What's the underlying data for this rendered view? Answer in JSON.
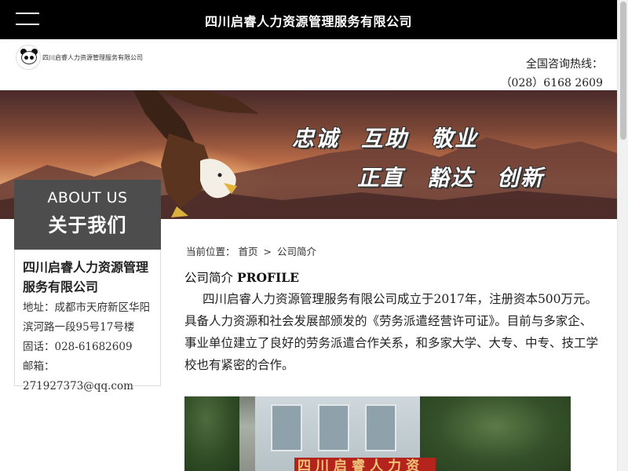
{
  "header": {
    "site_title": "四川启睿人力资源管理服务有限公司",
    "logo_text": "四川启睿人力资源管理服务有限公司",
    "hotline_label": "全国咨询热线：",
    "hotline_number": "（028）6168 2609"
  },
  "banner": {
    "slogans": [
      "忠诚",
      "互助",
      "敬业",
      "正直",
      "豁达",
      "创新"
    ]
  },
  "sidebar": {
    "about_en": "ABOUT US",
    "about_cn": "关于我们",
    "company_name": "四川启睿人力资源管理服务有限公司",
    "address": "地址：成都市天府新区华阳滨河路一段95号17号楼",
    "phone": "固话：028-61682609",
    "email": "邮箱：271927373@qq.com"
  },
  "content": {
    "breadcrumb_label": "当前位置：",
    "breadcrumb_home": "首页",
    "breadcrumb_sep": ">",
    "breadcrumb_current": "公司简介",
    "section_title_cn": "公司简介",
    "section_title_en": "PROFILE",
    "intro": "四川启睿人力资源管理服务有限公司成立于2017年，注册资本500万元。具备人力资源和社会发展部颁发的《劳务派遣经营许可证》。目前与多家企、事业单位建立了良好的劳务派遣合作关系，和多家大学、大专、中专、技工学校也有紧密的合作。",
    "photo_sign_text": "四川启睿人力资源"
  },
  "icons": {
    "menu": "hamburger-menu-icon",
    "logo": "panda-logo-icon"
  },
  "colors": {
    "topbar_bg": "#000000",
    "about_bg": "#4d4d4d"
  }
}
